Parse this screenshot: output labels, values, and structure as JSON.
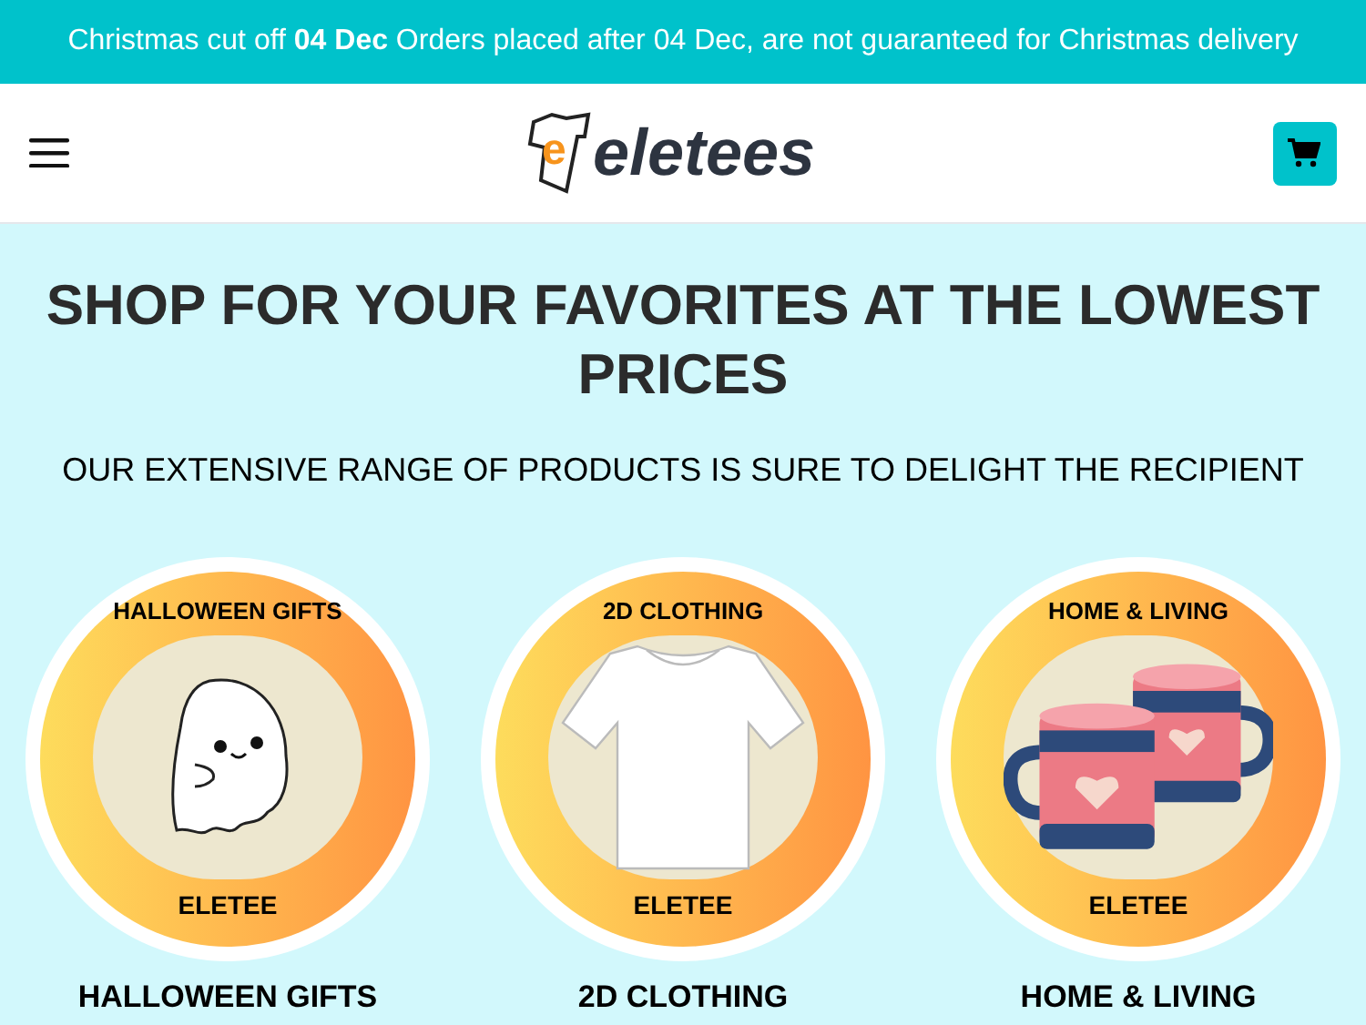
{
  "banner": {
    "text": "Christmas cut off **04 Dec** Orders placed after 04 Dec, are not guaranteed for Christmas delivery"
  },
  "header": {
    "logo_mark": "e",
    "logo_text": "eletees"
  },
  "hero": {
    "title": "SHOP FOR YOUR FAVORITES AT THE LOWEST PRICES",
    "subtitle": "OUR EXTENSIVE RANGE OF PRODUCTS IS SURE TO DELIGHT THE RECIPIENT"
  },
  "categories": [
    {
      "kind": "ghost",
      "badge_top": "HALLOWEEN GIFTS",
      "badge_bottom": "ELETEE",
      "label": "HALLOWEEN GIFTS"
    },
    {
      "kind": "tshirt",
      "badge_top": "2D CLOTHING",
      "badge_bottom": "ELETEE",
      "label": "2D CLOTHING"
    },
    {
      "kind": "mugs",
      "badge_top": "HOME & LIVING",
      "badge_bottom": "ELETEE",
      "label": "HOME & LIVING"
    }
  ]
}
